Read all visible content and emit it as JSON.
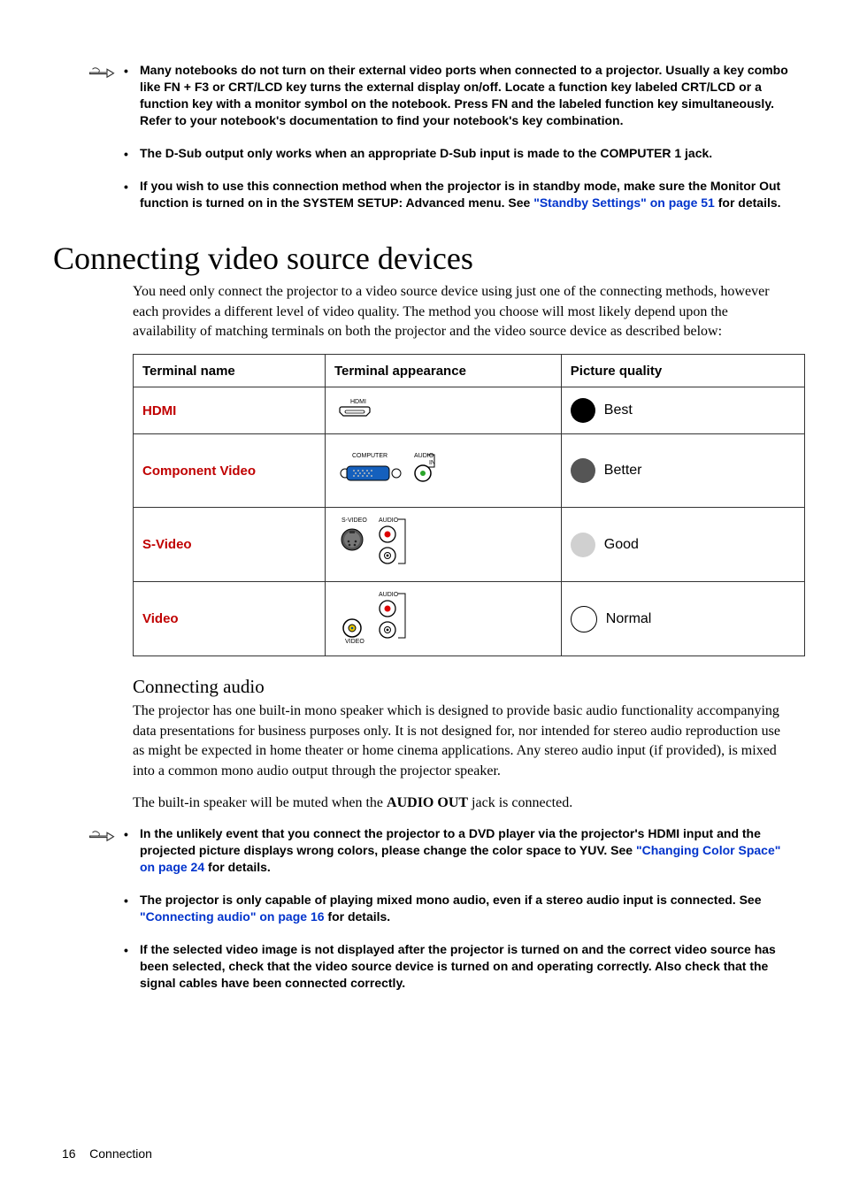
{
  "top_notes": [
    {
      "pre": "",
      "text": "Many notebooks do not turn on their external video ports when connected to a projector. Usually a key combo like FN + F3 or CRT/LCD key turns the external display on/off. Locate a function key labeled CRT/LCD or a function key with a monitor symbol on the notebook. Press FN and the labeled function key simultaneously. Refer to your notebook's documentation to find your notebook's key combination."
    },
    {
      "pre": "",
      "text": "The D-Sub output only works when an appropriate D-Sub input is made to the COMPUTER 1 jack."
    },
    {
      "pre": "If you wish to use this connection method when the projector is in standby mode, make sure the Monitor Out function is turned on in the SYSTEM SETUP: Advanced menu. See ",
      "link": "\"Standby Settings\" on page 51",
      "post": " for details."
    }
  ],
  "heading1": "Connecting video source devices",
  "para1": "You need only connect the projector to a video source device using just one of the connecting methods, however each provides a different level of video quality. The method you choose will most likely depend upon the availability of matching terminals on both the projector and the video source device as described below:",
  "table": {
    "headers": [
      "Terminal name",
      "Terminal appearance",
      "Picture quality"
    ],
    "rows": [
      {
        "name": "HDMI",
        "quality": "Best",
        "color": "#000000"
      },
      {
        "name": "Component Video",
        "quality": "Better",
        "color": "#555555"
      },
      {
        "name": "S-Video",
        "quality": "Good",
        "color": "#d0d0d0"
      },
      {
        "name": "Video",
        "quality": "Normal",
        "color": "#ffffff"
      }
    ]
  },
  "heading2": "Connecting audio",
  "para2": "The projector has one built-in mono speaker which is designed to provide basic audio functionality accompanying data presentations for business purposes only. It is not designed for, nor intended for stereo audio reproduction use as might be expected in home theater or home cinema applications. Any stereo audio input (if provided), is mixed into a common mono audio output through the projector speaker.",
  "para3_pre": "The built-in speaker will be muted when the ",
  "para3_bold": "AUDIO OUT",
  "para3_post": " jack is connected.",
  "bottom_notes": [
    {
      "pre": "In the unlikely event that you connect the projector to a DVD player via the projector's HDMI input and the projected picture displays wrong colors, please change the color space to YUV. See ",
      "link": "\"Changing Color Space\" on page 24",
      "post": " for details."
    },
    {
      "pre": "The projector is only capable of playing mixed mono audio, even if a stereo audio input is connected. See ",
      "link": "\"Connecting audio\" on page 16",
      "post": " for details."
    },
    {
      "pre": "",
      "text": "If the selected video image is not displayed after the projector is turned on and the correct video source has been selected, check that the video source device is turned on and operating correctly. Also check that the signal cables have been connected correctly."
    }
  ],
  "footer": {
    "pagenum": "16",
    "section": "Connection"
  }
}
